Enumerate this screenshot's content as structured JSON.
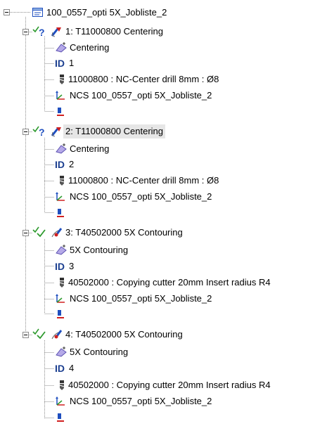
{
  "root": {
    "label": "100_0557_opti 5X_Jobliste_2",
    "icon": "program-list-icon"
  },
  "jobs": [
    {
      "label": "1: T11000800 Centering",
      "icon": "drill-operation-icon",
      "status": [
        "check-mark-icon",
        "question-mark-icon"
      ],
      "selected": false,
      "children": {
        "operation": "Centering",
        "id_label": "ID",
        "id_value": "1",
        "tool": "11000800 :  NC-Center drill  8mm : Ø8",
        "ncs": "NCS 100_0557_opti 5X_Jobliste_2"
      }
    },
    {
      "label": "2: T11000800 Centering",
      "icon": "drill-operation-icon",
      "status": [
        "check-mark-icon",
        "question-mark-icon"
      ],
      "selected": true,
      "children": {
        "operation": "Centering",
        "id_label": "ID",
        "id_value": "2",
        "tool": "11000800 :  NC-Center drill  8mm : Ø8",
        "ncs": "NCS 100_0557_opti 5X_Jobliste_2"
      }
    },
    {
      "label": "3: T40502000 5X Contouring",
      "icon": "contouring-operation-icon",
      "status": [
        "check-mark-icon",
        "check-mark-icon"
      ],
      "selected": false,
      "children": {
        "operation": "5X Contouring",
        "id_label": "ID",
        "id_value": "3",
        "tool": "40502000 :  Copying cutter  20mm Insert radius R4",
        "ncs": "NCS 100_0557_opti 5X_Jobliste_2"
      }
    },
    {
      "label": "4: T40502000 5X Contouring",
      "icon": "contouring-operation-icon",
      "status": [
        "check-mark-icon",
        "check-mark-icon"
      ],
      "selected": false,
      "children": {
        "operation": "5X Contouring",
        "id_label": "ID",
        "id_value": "4",
        "tool": "40502000 :  Copying cutter  20mm Insert radius R4",
        "ncs": "NCS 100_0557_opti 5X_Jobliste_2"
      }
    }
  ],
  "colors": {
    "tree_line": "#8c8c8c",
    "id_blue": "#1a3e8f",
    "check_green": "#2e9a2e",
    "question_blue": "#1f4fbf",
    "selection": "#e6e6e6"
  }
}
